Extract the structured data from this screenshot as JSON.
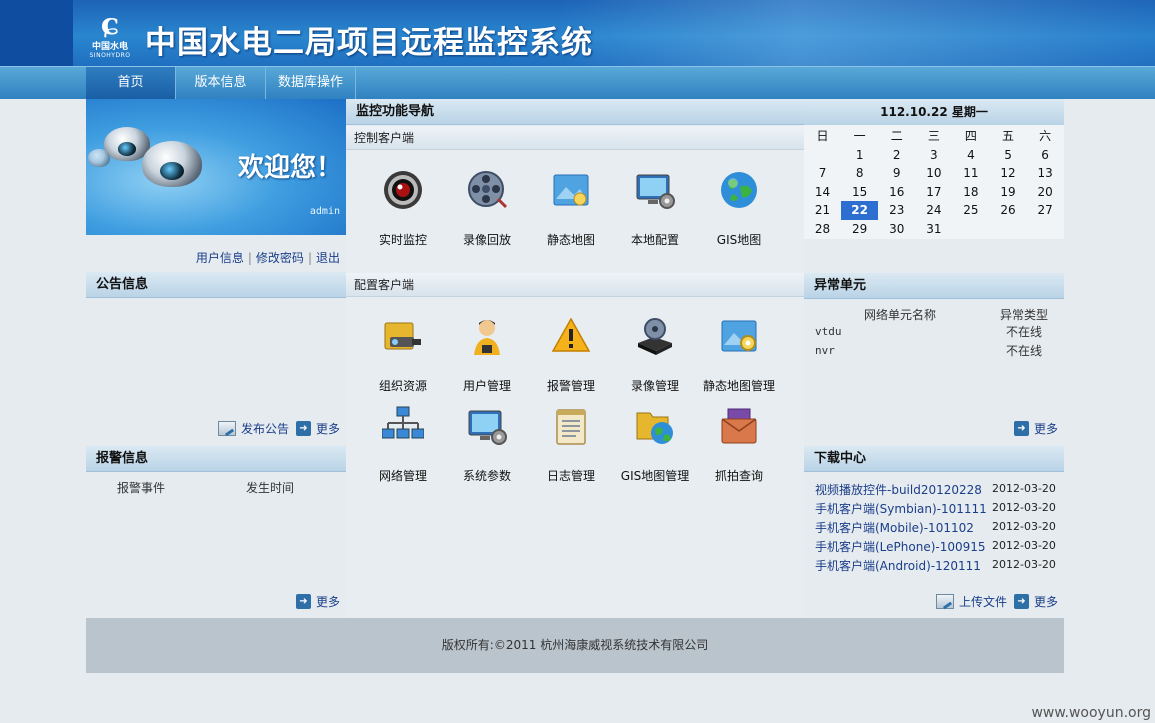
{
  "header": {
    "title": "中国水电二局项目远程监控系统",
    "logo_cn": "中国水电",
    "logo_en": "SINOHYDRO"
  },
  "nav": {
    "items": [
      {
        "label": "首页",
        "active": true
      },
      {
        "label": "版本信息",
        "active": false
      },
      {
        "label": "数据库操作",
        "active": false
      }
    ]
  },
  "welcome": {
    "greeting": "欢迎您！",
    "username": "admin",
    "links": {
      "user_info": "用户信息",
      "change_password": "修改密码",
      "logout": "退出",
      "sep": "|"
    }
  },
  "notice": {
    "title": "公告信息",
    "publish_label": "发布公告",
    "more_label": "更多"
  },
  "alarm": {
    "title": "报警信息",
    "col_event": "报警事件",
    "col_time": "发生时间",
    "more_label": "更多"
  },
  "monitor": {
    "title": "监控功能导航",
    "control_section": "控制客户端",
    "config_section": "配置客户端",
    "control_items": [
      {
        "label": "实时监控",
        "icon": "camera-icon"
      },
      {
        "label": "录像回放",
        "icon": "film-reel-icon"
      },
      {
        "label": "静态地图",
        "icon": "map-icon"
      },
      {
        "label": "本地配置",
        "icon": "monitor-gear-icon"
      },
      {
        "label": "GIS地图",
        "icon": "globe-icon"
      }
    ],
    "config_items": [
      {
        "label": "组织资源",
        "icon": "folder-camera-icon"
      },
      {
        "label": "用户管理",
        "icon": "user-icon"
      },
      {
        "label": "报警管理",
        "icon": "warning-icon"
      },
      {
        "label": "录像管理",
        "icon": "video-recorder-icon"
      },
      {
        "label": "静态地图管理",
        "icon": "map-gear-icon"
      },
      {
        "label": "网络管理",
        "icon": "network-icon"
      },
      {
        "label": "系统参数",
        "icon": "monitor-gear-icon"
      },
      {
        "label": "日志管理",
        "icon": "notepad-icon"
      },
      {
        "label": "GIS地图管理",
        "icon": "folder-globe-icon"
      },
      {
        "label": "抓拍查询",
        "icon": "photo-envelope-icon"
      }
    ]
  },
  "calendar": {
    "title": "112.10.22 星期一",
    "weekdays": [
      "日",
      "一",
      "二",
      "三",
      "四",
      "五",
      "六"
    ],
    "today": "22",
    "weeks": [
      [
        "",
        "1",
        "2",
        "3",
        "4",
        "5",
        "6"
      ],
      [
        "7",
        "8",
        "9",
        "10",
        "11",
        "12",
        "13"
      ],
      [
        "14",
        "15",
        "16",
        "17",
        "18",
        "19",
        "20"
      ],
      [
        "21",
        "22",
        "23",
        "24",
        "25",
        "26",
        "27"
      ],
      [
        "28",
        "29",
        "30",
        "31",
        "",
        "",
        ""
      ]
    ]
  },
  "abnormal": {
    "title": "异常单元",
    "col_name": "网络单元名称",
    "col_type": "异常类型",
    "rows": [
      {
        "name": "vtdu",
        "type": "不在线"
      },
      {
        "name": "nvr",
        "type": "不在线"
      }
    ],
    "more_label": "更多"
  },
  "download": {
    "title": "下载中心",
    "items": [
      {
        "name": "视频播放控件-build20120228",
        "date": "2012-03-20"
      },
      {
        "name": "手机客户端(Symbian)-101111",
        "date": "2012-03-20"
      },
      {
        "name": "手机客户端(Mobile)-101102",
        "date": "2012-03-20"
      },
      {
        "name": "手机客户端(LePhone)-100915",
        "date": "2012-03-20"
      },
      {
        "name": "手机客户端(Android)-120111",
        "date": "2012-03-20"
      }
    ],
    "upload_label": "上传文件",
    "more_label": "更多"
  },
  "footer": {
    "copyright": "版权所有:©2011 杭州海康威视系统技术有限公司"
  },
  "watermark": "www.wooyun.org",
  "colors": {
    "header_blue": "#1d63b6",
    "nav_blue": "#2f82c0",
    "today_highlight": "#2c6fd0",
    "link_color": "#1a3e8a"
  }
}
